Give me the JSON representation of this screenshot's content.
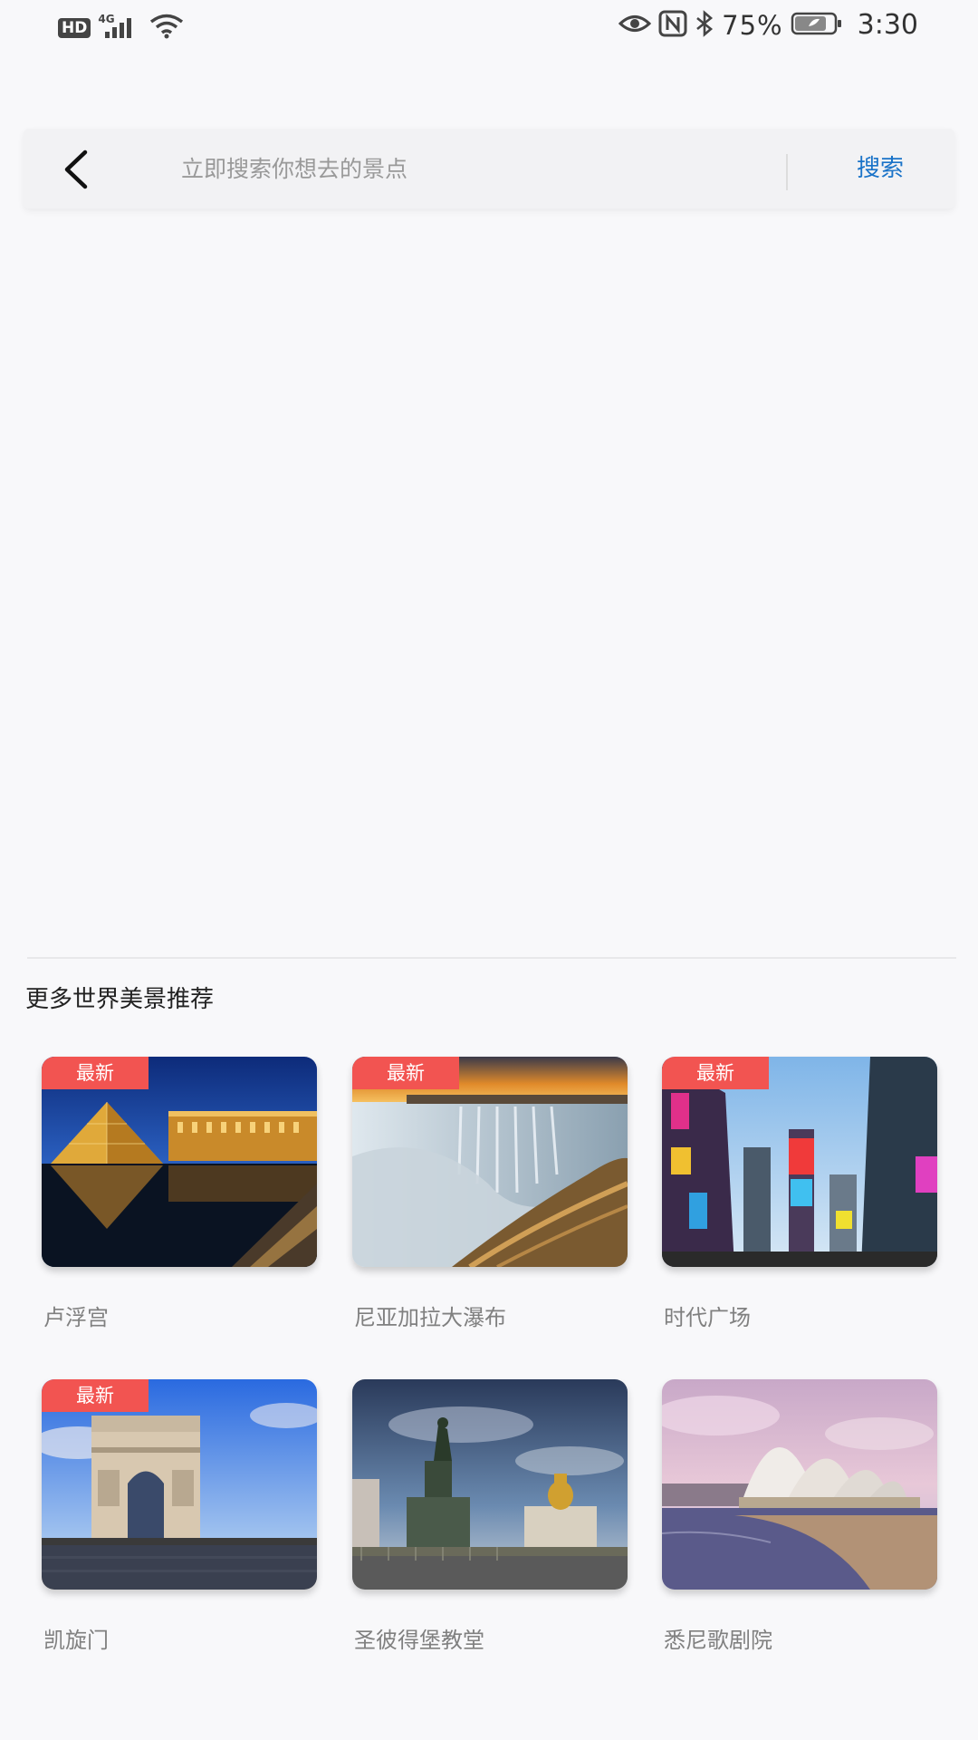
{
  "status_bar": {
    "hd": "HD",
    "network": "4G",
    "battery": "75%",
    "time": "3:30"
  },
  "search": {
    "placeholder": "立即搜索你想去的景点",
    "button_label": "搜索"
  },
  "section": {
    "title": "更多世界美景推荐"
  },
  "badge_label": "最新",
  "cards": [
    {
      "name": "卢浮宫",
      "badge": "最新"
    },
    {
      "name": "尼亚加拉大瀑布",
      "badge": "最新"
    },
    {
      "name": "时代广场",
      "badge": "最新"
    },
    {
      "name": "凯旋门",
      "badge": "最新"
    },
    {
      "name": "圣彼得堡教堂",
      "badge": ""
    },
    {
      "name": "悉尼歌剧院",
      "badge": ""
    }
  ],
  "colors": {
    "accent": "#1a73c8",
    "badge": "#f25451",
    "background": "#f8f8fa"
  }
}
